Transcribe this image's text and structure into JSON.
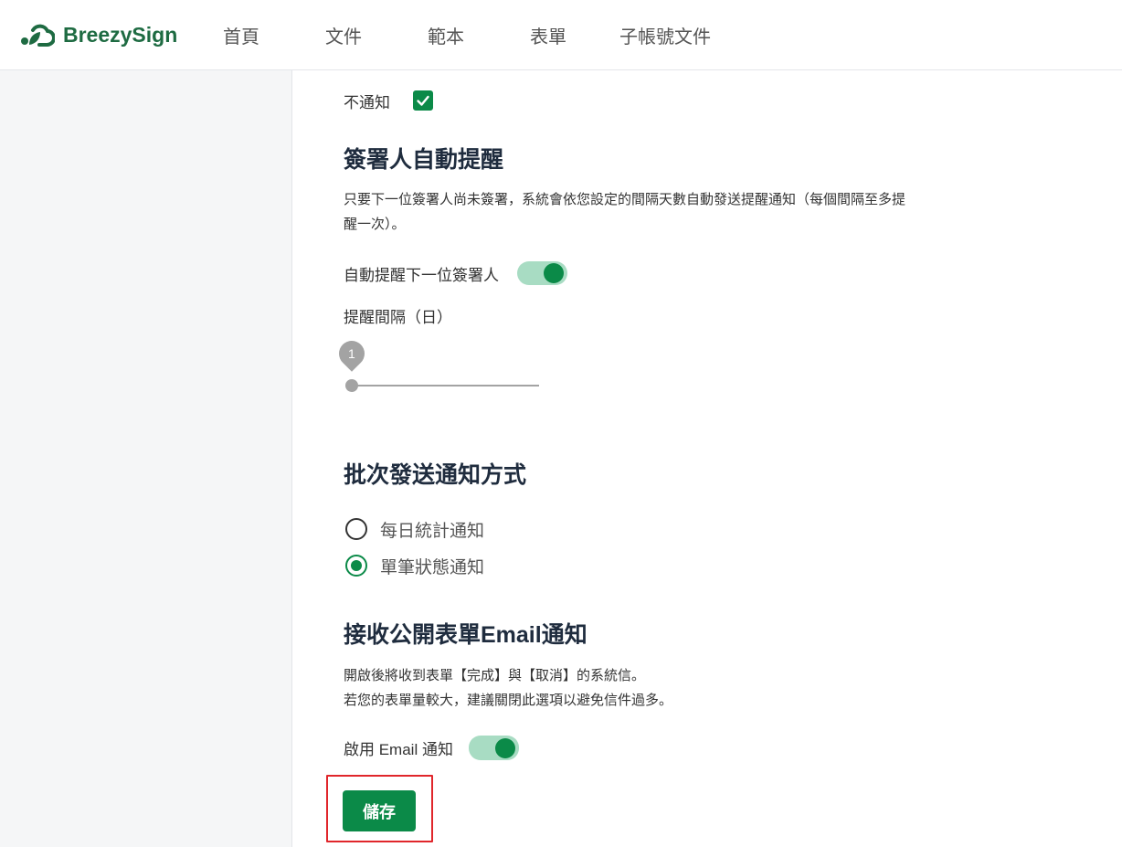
{
  "brand": {
    "name": "BreezySign",
    "icon": "breezysign-logo-icon"
  },
  "nav": {
    "items": [
      {
        "label": "首頁"
      },
      {
        "label": "文件"
      },
      {
        "label": "範本"
      },
      {
        "label": "表單"
      },
      {
        "label": "子帳號文件"
      }
    ]
  },
  "no_notify": {
    "label": "不通知",
    "checked": true,
    "icon": "check-icon"
  },
  "reminder": {
    "heading": "簽署人自動提醒",
    "description": [
      "只要下一位簽署人尚未簽署，系統會依您設定的間隔天數自動發送提醒通知（每個間隔至多提",
      "醒一次）。"
    ],
    "auto_label": "自動提醒下一位簽署人",
    "auto_enabled": true,
    "interval_label": "提醒間隔（日）",
    "interval_value": 1
  },
  "batch": {
    "heading": "批次發送通知方式",
    "options": [
      {
        "label": "每日統計通知",
        "selected": false
      },
      {
        "label": "單筆狀態通知",
        "selected": true
      }
    ]
  },
  "public_form": {
    "heading": "接收公開表單Email通知",
    "notes": [
      "開啟後將收到表單【完成】與【取消】的系統信。",
      "若您的表單量較大，建議關閉此選項以避免信件過多。"
    ],
    "email_label": "啟用 Email 通知",
    "email_enabled": true
  },
  "actions": {
    "save_label": "儲存"
  },
  "colors": {
    "accent": "#0b8a48",
    "toggle_track": "#a8dcc3",
    "brand_text": "#1e6b42",
    "heading": "#1f2c3e",
    "slider": "#a3a3a3",
    "highlight": "#e0262b",
    "sidebar_bg": "#f5f6f7"
  }
}
